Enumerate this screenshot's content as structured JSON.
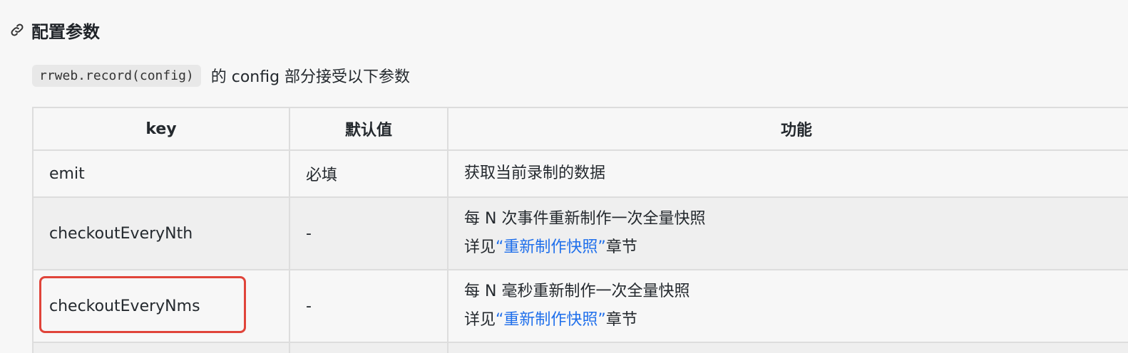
{
  "section": {
    "title": "配置参数",
    "icon": "link-icon"
  },
  "intro": {
    "code": "rrweb.record(config)",
    "text": "的 config 部分接受以下参数"
  },
  "table": {
    "headers": [
      "key",
      "默认值",
      "功能"
    ],
    "rows": [
      {
        "key": "emit",
        "default": "必填",
        "desc_line1": "获取当前录制的数据",
        "desc_prefix": "",
        "desc_link": "",
        "desc_suffix": ""
      },
      {
        "key": "checkoutEveryNth",
        "default": "-",
        "desc_line1": "每 N 次事件重新制作一次全量快照",
        "desc_prefix": "详见",
        "desc_link": "“重新制作快照”",
        "desc_suffix": "章节"
      },
      {
        "key": "checkoutEveryNms",
        "default": "-",
        "desc_line1": "每 N 毫秒重新制作一次全量快照",
        "desc_prefix": "详见",
        "desc_link": "“重新制作快照”",
        "desc_suffix": "章节"
      }
    ]
  },
  "colors": {
    "link": "#1f6feb",
    "highlight_border": "#e0443a"
  }
}
